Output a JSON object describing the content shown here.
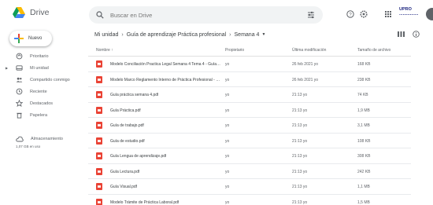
{
  "app": {
    "name": "Drive"
  },
  "search": {
    "placeholder": "Buscar en Drive"
  },
  "header": {
    "org_badge": "UPRO ................"
  },
  "sidebar": {
    "new_label": "Nuevo",
    "items": [
      {
        "label": "Prioritario",
        "icon": "home-icon"
      },
      {
        "label": "Mi unidad",
        "icon": "drive-icon"
      },
      {
        "label": "Compartido conmigo",
        "icon": "shared-icon"
      },
      {
        "label": "Reciente",
        "icon": "clock-icon"
      },
      {
        "label": "Destacados",
        "icon": "star-icon"
      },
      {
        "label": "Papelera",
        "icon": "trash-icon"
      }
    ],
    "storage_label": "Almacenamiento",
    "storage_used": "1,07 GB en uso"
  },
  "breadcrumb": {
    "items": [
      "Mi unidad",
      "Guía de aprendizaje Práctica profesional",
      "Semana 4"
    ]
  },
  "table": {
    "headers": {
      "name": "Nombre",
      "owner": "Propietario",
      "modified": "Última modificación",
      "size": "Tamaño de archivo"
    },
    "rows": [
      {
        "name": "Modelo Conciliación Practica Legal Semana 4 Tema 4 - Guía Práctica.pdf",
        "owner": "yo",
        "modified": "26 feb 2021 yo",
        "size": "168 KB"
      },
      {
        "name": "Modelo Marco Reglamento Interno de Práctica Profesional - UPRO...",
        "owner": "yo",
        "modified": "26 feb 2021 yo",
        "size": "238 KB"
      },
      {
        "name": "Guía práctica semana 4.pdf",
        "owner": "yo",
        "modified": "21:13 yo",
        "size": "74 KB"
      },
      {
        "name": "Guía Práctica.pdf",
        "owner": "yo",
        "modified": "21:13 yo",
        "size": "1,9 MB"
      },
      {
        "name": "Guía de trabajo.pdf",
        "owner": "yo",
        "modified": "21:13 yo",
        "size": "3,1 MB"
      },
      {
        "name": "Guía de estudio.pdf",
        "owner": "yo",
        "modified": "21:13 yo",
        "size": "108 KB"
      },
      {
        "name": "Guía Lengua de aprendizaje.pdf",
        "owner": "yo",
        "modified": "21:13 yo",
        "size": "308 KB"
      },
      {
        "name": "Guía Lectura.pdf",
        "owner": "yo",
        "modified": "21:13 yo",
        "size": "242 KB"
      },
      {
        "name": "Guía Visual.pdf",
        "owner": "yo",
        "modified": "21:13 yo",
        "size": "1,1 MB"
      },
      {
        "name": "Modelo Trámite de Práctica Laboral.pdf",
        "owner": "yo",
        "modified": "21:13 yo",
        "size": "1,5 MB"
      }
    ]
  },
  "colors": {
    "pdf_red": "#ea4335",
    "search_bg": "#f1f3f4",
    "text": "#3c4043"
  }
}
